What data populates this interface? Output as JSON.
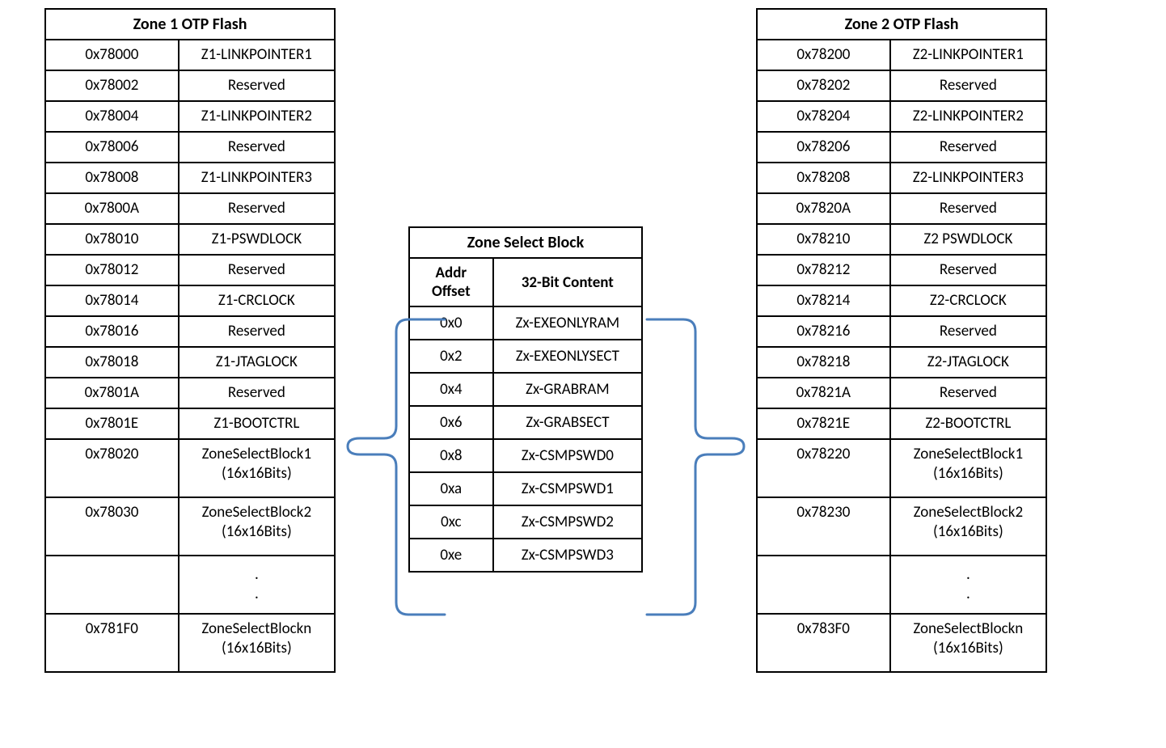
{
  "zone1": {
    "title": "Zone 1 OTP Flash",
    "rows": [
      {
        "addr": "0x78000",
        "name": "Z1-LINKPOINTER1"
      },
      {
        "addr": "0x78002",
        "name": "Reserved"
      },
      {
        "addr": "0x78004",
        "name": "Z1-LINKPOINTER2"
      },
      {
        "addr": "0x78006",
        "name": "Reserved"
      },
      {
        "addr": "0x78008",
        "name": "Z1-LINKPOINTER3"
      },
      {
        "addr": "0x7800A",
        "name": "Reserved"
      },
      {
        "addr": "0x78010",
        "name": "Z1-PSWDLOCK"
      },
      {
        "addr": "0x78012",
        "name": "Reserved"
      },
      {
        "addr": "0x78014",
        "name": "Z1-CRCLOCK"
      },
      {
        "addr": "0x78016",
        "name": "Reserved"
      },
      {
        "addr": "0x78018",
        "name": "Z1-JTAGLOCK"
      },
      {
        "addr": "0x7801A",
        "name": "Reserved"
      },
      {
        "addr": "0x7801E",
        "name": "Z1-BOOTCTRL"
      },
      {
        "addr": "0x78020",
        "name": "ZoneSelectBlock1\n(16x16Bits)"
      },
      {
        "addr": "0x78030",
        "name": "ZoneSelectBlock2\n(16x16Bits)"
      },
      {
        "addr": "",
        "name": ".\n."
      },
      {
        "addr": "0x781F0",
        "name": "ZoneSelectBlockn\n(16x16Bits)"
      }
    ]
  },
  "zone2": {
    "title": "Zone 2 OTP Flash",
    "rows": [
      {
        "addr": "0x78200",
        "name": "Z2-LINKPOINTER1"
      },
      {
        "addr": "0x78202",
        "name": "Reserved"
      },
      {
        "addr": "0x78204",
        "name": "Z2-LINKPOINTER2"
      },
      {
        "addr": "0x78206",
        "name": "Reserved"
      },
      {
        "addr": "0x78208",
        "name": "Z2-LINKPOINTER3"
      },
      {
        "addr": "0x7820A",
        "name": "Reserved"
      },
      {
        "addr": "0x78210",
        "name": "Z2 PSWDLOCK"
      },
      {
        "addr": "0x78212",
        "name": "Reserved"
      },
      {
        "addr": "0x78214",
        "name": "Z2-CRCLOCK"
      },
      {
        "addr": "0x78216",
        "name": "Reserved"
      },
      {
        "addr": "0x78218",
        "name": "Z2-JTAGLOCK"
      },
      {
        "addr": "0x7821A",
        "name": "Reserved"
      },
      {
        "addr": "0x7821E",
        "name": "Z2-BOOTCTRL"
      },
      {
        "addr": "0x78220",
        "name": "ZoneSelectBlock1\n(16x16Bits)"
      },
      {
        "addr": "0x78230",
        "name": "ZoneSelectBlock2\n(16x16Bits)"
      },
      {
        "addr": "",
        "name": ".\n."
      },
      {
        "addr": "0x783F0",
        "name": "ZoneSelectBlockn\n(16x16Bits)"
      }
    ]
  },
  "zsb": {
    "title": "Zone Select Block",
    "head_offset": "Addr\nOffset",
    "head_content": "32-Bit Content",
    "rows": [
      {
        "off": "0x0",
        "name": "Zx-EXEONLYRAM"
      },
      {
        "off": "0x2",
        "name": "Zx-EXEONLYSECT"
      },
      {
        "off": "0x4",
        "name": "Zx-GRABRAM"
      },
      {
        "off": "0x6",
        "name": "Zx-GRABSECT"
      },
      {
        "off": "0x8",
        "name": "Zx-CSMPSWD0"
      },
      {
        "off": "0xa",
        "name": "Zx-CSMPSWD1"
      },
      {
        "off": "0xc",
        "name": "Zx-CSMPSWD2"
      },
      {
        "off": "0xe",
        "name": "Zx-CSMPSWD3"
      }
    ]
  }
}
